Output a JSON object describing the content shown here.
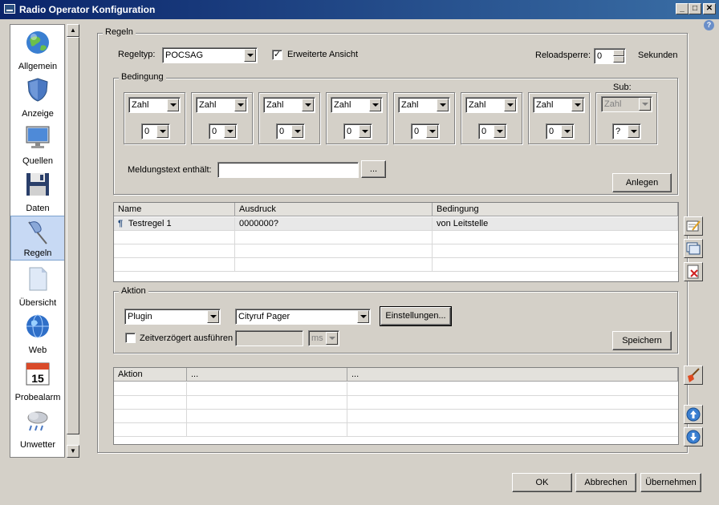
{
  "window": {
    "title": "Radio Operator Konfiguration",
    "help_glyph": "?"
  },
  "sidebar": {
    "items": [
      {
        "label": "Allgemein",
        "icon": "globe-icon"
      },
      {
        "label": "Anzeige",
        "icon": "shield-icon"
      },
      {
        "label": "Quellen",
        "icon": "monitor-icon"
      },
      {
        "label": "Daten",
        "icon": "floppy-disk-icon"
      },
      {
        "label": "Regeln",
        "icon": "flag-icon",
        "selected": true
      },
      {
        "label": "Übersicht",
        "icon": "document-icon"
      },
      {
        "label": "Web",
        "icon": "globe-icon"
      },
      {
        "label": "Probealarm",
        "icon": "calendar-icon",
        "calendar_day": "15"
      },
      {
        "label": "Unwetter",
        "icon": "weather-icon"
      }
    ]
  },
  "regeln": {
    "group_label": "Regeln",
    "regeltyp_label": "Regeltyp:",
    "regeltyp_value": "POCSAG",
    "erweitert_label": "Erweiterte Ansicht",
    "erweitert_checked": "✓",
    "reload_label": "Reloadsperre:",
    "reload_value": "0",
    "reload_unit": "Sekunden"
  },
  "bedingung": {
    "group_label": "Bedingung",
    "sub_label": "Sub:",
    "slots": [
      {
        "type": "Zahl",
        "value": "0"
      },
      {
        "type": "Zahl",
        "value": "0"
      },
      {
        "type": "Zahl",
        "value": "0"
      },
      {
        "type": "Zahl",
        "value": "0"
      },
      {
        "type": "Zahl",
        "value": "0"
      },
      {
        "type": "Zahl",
        "value": "0"
      },
      {
        "type": "Zahl",
        "value": "0"
      }
    ],
    "sub_slot": {
      "type": "Zahl",
      "value": "?"
    },
    "meldungstext_label": "Meldungstext enthält:",
    "meldungstext_value": "",
    "browse_label": "...",
    "anlegen_label": "Anlegen"
  },
  "rules_table": {
    "columns": [
      "Name",
      "Ausdruck",
      "Bedingung"
    ],
    "rows": [
      {
        "name": "Testregel 1",
        "ausdruck": "0000000?",
        "bedingung": "von Leitstelle"
      }
    ]
  },
  "aktion": {
    "group_label": "Aktion",
    "type_value": "Plugin",
    "plugin_value": "Cityruf Pager",
    "einstellungen_label": "Einstellungen...",
    "delay_label": "Zeitverzögert ausführen",
    "delay_value": "",
    "delay_unit": "ms",
    "speichern_label": "Speichern"
  },
  "actions_table": {
    "columns": [
      "Aktion",
      "...",
      "..."
    ]
  },
  "footer": {
    "ok_label": "OK",
    "cancel_label": "Abbrechen",
    "apply_label": "Übernehmen"
  }
}
